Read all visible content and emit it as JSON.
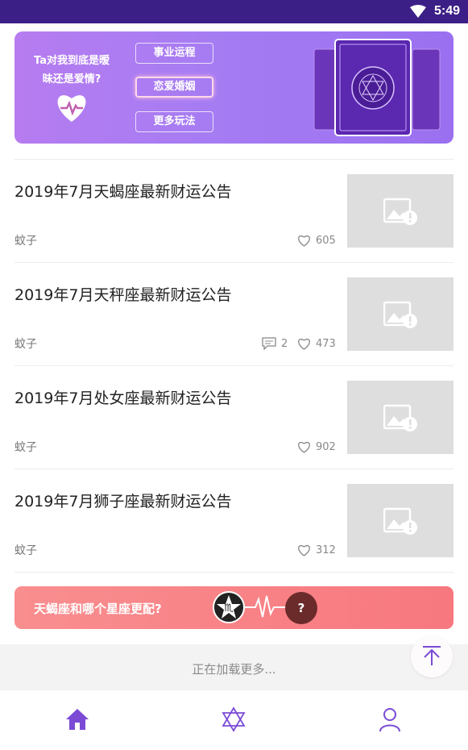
{
  "status_bar": {
    "time": "5:49"
  },
  "banner": {
    "question": "Ta对我到底是暧昧还是爱情?",
    "buttons": [
      "事业运程",
      "恋爱婚姻",
      "更多玩法"
    ],
    "active_button": "恋爱婚姻"
  },
  "articles": [
    {
      "title": "2019年7月天蝎座最新财运公告",
      "author": "蚊子",
      "comments": "",
      "likes": "605"
    },
    {
      "title": "2019年7月天秤座最新财运公告",
      "author": "蚊子",
      "comments": "2",
      "likes": "473"
    },
    {
      "title": "2019年7月处女座最新财运公告",
      "author": "蚊子",
      "comments": "",
      "likes": "902"
    },
    {
      "title": "2019年7月狮子座最新财运公告",
      "author": "蚊子",
      "comments": "",
      "likes": "312"
    }
  ],
  "promo": {
    "text": "天蝎座和哪个星座更配?",
    "question_mark": "?"
  },
  "loading": {
    "text": "正在加载更多..."
  },
  "tabbar": {
    "items": [
      {
        "icon": "home-icon",
        "active": true
      },
      {
        "icon": "star-of-david-icon",
        "active": false
      },
      {
        "icon": "user-icon",
        "active": false
      }
    ]
  },
  "colors": {
    "accent": "#7b4bd6",
    "status_bar": "#3c1f86",
    "promo": "#f7787f"
  }
}
